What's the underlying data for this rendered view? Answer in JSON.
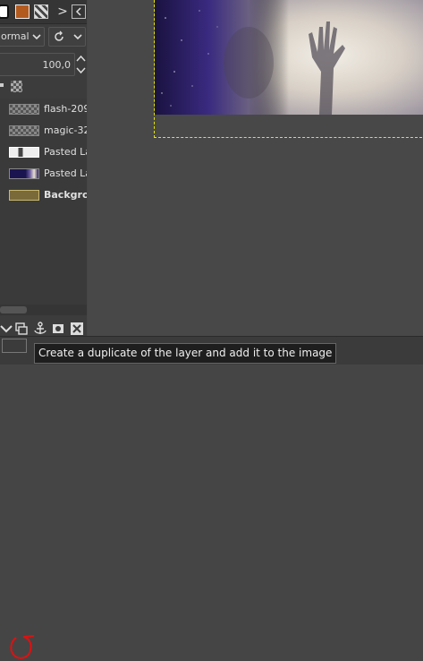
{
  "mode": {
    "label": "ormal"
  },
  "opacity": {
    "value": "100,0"
  },
  "layers": [
    {
      "name": "flash-209",
      "bold": false
    },
    {
      "name": "magic-32",
      "bold": false
    },
    {
      "name": "Pasted La",
      "bold": false
    },
    {
      "name": "Pasted La",
      "bold": false
    },
    {
      "name": "Backgro",
      "bold": true
    }
  ],
  "tooltip": {
    "text": "Create a duplicate of the layer and add it to the image"
  },
  "colors": {
    "selection": "#e6e600",
    "annotation": "#e01010",
    "bg_layer": "#7a6a3a"
  }
}
